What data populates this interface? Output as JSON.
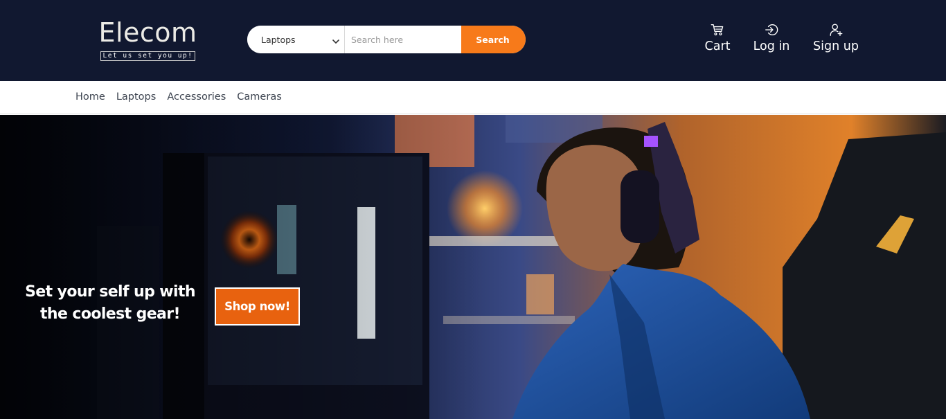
{
  "brand": {
    "name": "Elecom",
    "tagline": "Let us set you up!"
  },
  "search": {
    "category_selected": "Laptops",
    "placeholder": "Search here",
    "button_label": "Search"
  },
  "header_actions": {
    "cart": {
      "label": "Cart",
      "icon": "cart-icon"
    },
    "login": {
      "label": "Log in",
      "icon": "login-icon"
    },
    "signup": {
      "label": "Sign up",
      "icon": "user-add-icon"
    }
  },
  "nav": {
    "items": [
      {
        "label": "Home"
      },
      {
        "label": "Laptops"
      },
      {
        "label": "Accessories"
      },
      {
        "label": "Cameras"
      }
    ]
  },
  "hero": {
    "headline": "Set your self up with the coolest gear!",
    "cta_label": "Shop now!"
  },
  "colors": {
    "header_bg": "#111830",
    "accent": "#f77a1a",
    "cta": "#e8620f",
    "nav_text": "#3d4450"
  }
}
